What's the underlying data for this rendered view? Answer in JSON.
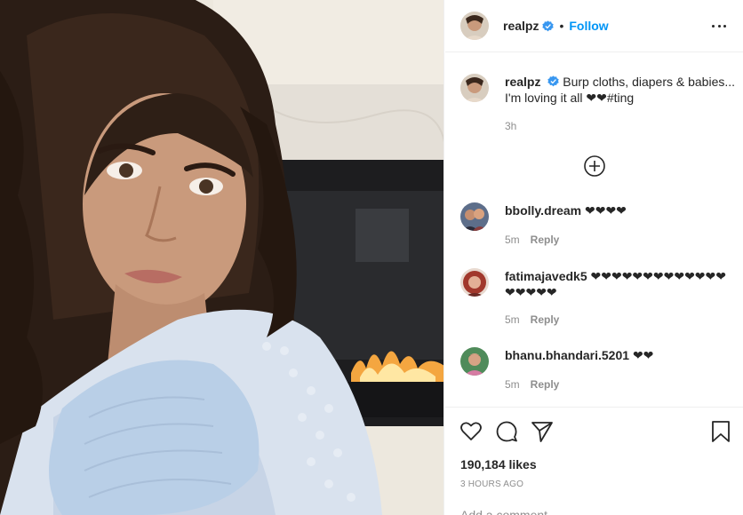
{
  "photo": {
    "alt": ""
  },
  "header": {
    "username": "realpz",
    "separator": "•",
    "follow_label": "Follow"
  },
  "caption": {
    "username": "realpz",
    "line1": "Burp cloths, diapers & babies...",
    "line2": "I'm loving it all ❤❤#ting",
    "time": "3h"
  },
  "comments": [
    {
      "username": "bbolly.dream",
      "text": "❤❤❤❤",
      "time": "5m",
      "reply_label": "Reply"
    },
    {
      "username": "fatimajavedk5",
      "text": "❤❤❤❤❤❤❤❤❤❤❤❤❤ ❤❤❤❤❤",
      "time": "5m",
      "reply_label": "Reply"
    },
    {
      "username": "bhanu.bhandari.5201",
      "text": "❤❤",
      "time": "5m",
      "reply_label": "Reply"
    }
  ],
  "likes": "190,184 likes",
  "post_time": "3 HOURS AGO",
  "add_comment_placeholder": "Add a comment..."
}
